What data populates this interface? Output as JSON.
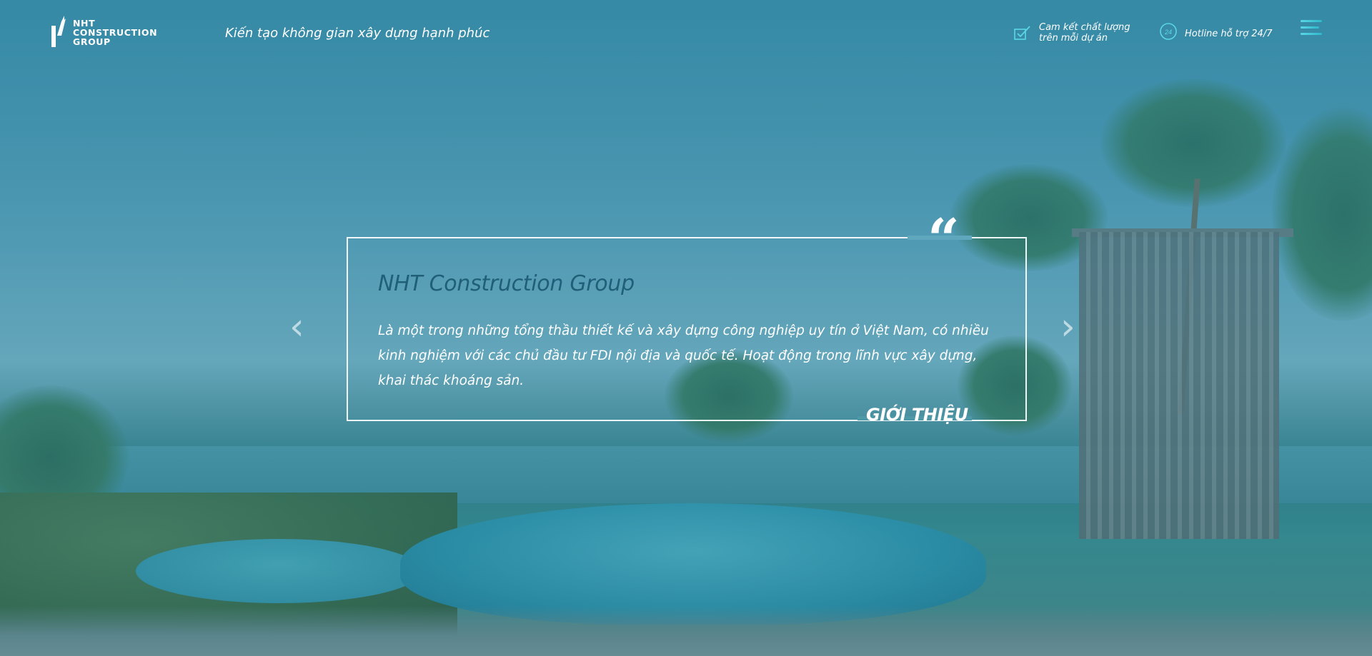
{
  "header": {
    "logo_lines": [
      "NHT",
      "CONSTRUCTION",
      "GROUP"
    ],
    "tagline": "Kiến tạo không gian xây dựng hạnh phúc",
    "quality_line1": "Cam kết chất lượng",
    "quality_line2": "trên mỗi dự án",
    "hotline_icon_text": "24",
    "hotline": "Hotline hỗ trợ 24/7",
    "menu_icon": "hamburger-icon"
  },
  "intro": {
    "quote_glyph": "“",
    "title": "NHT Construction Group",
    "body": "Là một trong những tổng thầu thiết kế và xây dựng công nghiệp uy tín ở Việt Nam, có nhiều kinh nghiệm với các chủ đầu tư FDI nội địa và quốc tế. Hoạt động trong lĩnh vực xây dựng, khai thác khoáng sản.",
    "footer_label": "GIỚI THIỆU"
  },
  "slider": {
    "prev_glyph": "‹",
    "next_glyph": "›"
  },
  "colors": {
    "accent": "#2fb8cc",
    "title": "#1f5f78"
  }
}
